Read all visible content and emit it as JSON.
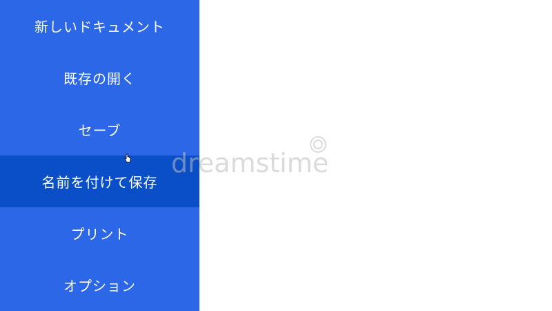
{
  "menu": {
    "items": [
      {
        "label": "新しいドキュメント",
        "active": false
      },
      {
        "label": "既存の開く",
        "active": false
      },
      {
        "label": "セーブ",
        "active": false
      },
      {
        "label": "名前を付けて保存",
        "active": true
      },
      {
        "label": "プリント",
        "active": false
      },
      {
        "label": "オプション",
        "active": false
      }
    ]
  },
  "colors": {
    "menu_bg": "#2b67e6",
    "menu_active_bg": "#0a4fc8",
    "menu_text": "#ffffff",
    "content_bg": "#ffffff"
  },
  "watermark": {
    "text": "dreamstime"
  },
  "cursor": {
    "icon": "hand-pointer-icon"
  }
}
